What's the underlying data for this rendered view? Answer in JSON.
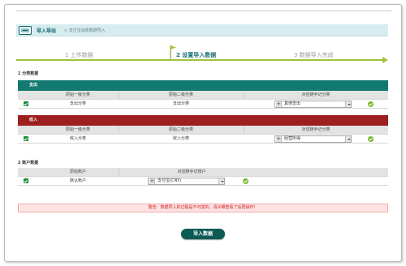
{
  "header": {
    "title": "导入导出",
    "breadcrumb": "> 支付宝消费数据导入"
  },
  "steps": [
    {
      "label": "1 上传数据",
      "active": false
    },
    {
      "label": "2 设置导入数据",
      "active": true
    },
    {
      "label": "3 数据导入完成",
      "active": false
    }
  ],
  "section1": {
    "title": "1 分类数据",
    "expense": {
      "band": "支出",
      "headers": [
        "原始一级分类",
        "原始二级分类",
        "对应随手记分类"
      ],
      "row": {
        "level1": "支出分类",
        "level2": "支出分类",
        "mapped": "其他支出"
      }
    },
    "income": {
      "band": "收入",
      "headers": [
        "原始一级分类",
        "原始二级分类",
        "对应随手记分类"
      ],
      "row": {
        "level1": "收入分类",
        "level2": "收入分类",
        "mapped": "经营所得"
      }
    }
  },
  "section2": {
    "title": "2 账户数据",
    "headers": [
      "原始账户",
      "对应随手记账户"
    ],
    "row": {
      "account": "默认账户",
      "mapped": "支付宝(CNY)"
    }
  },
  "warning": "警告：数据导入的过程是不可逆的，请仔细查看了后再操作！",
  "import_button": "导入数据",
  "colors": {
    "header_bg": "#d6ecef",
    "expense_band": "#137a71",
    "income_band": "#9e1f1f",
    "progress": "#9fc23b",
    "button": "#0e5b55"
  }
}
